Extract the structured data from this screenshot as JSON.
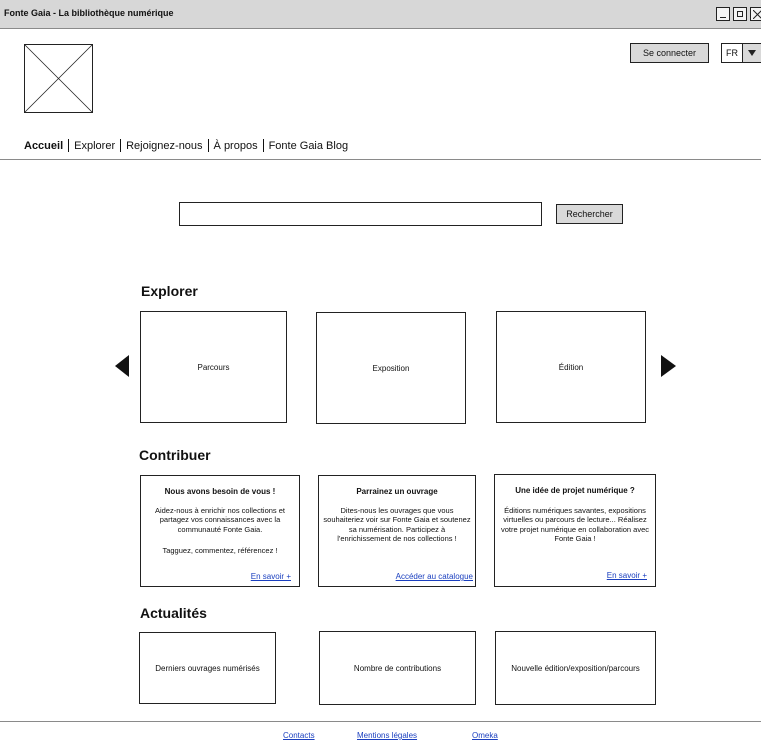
{
  "window": {
    "title": "Fonte Gaia - La bibliothèque numérique"
  },
  "header": {
    "login_label": "Se connecter",
    "language": "FR",
    "nav": [
      "Accueil",
      "Explorer",
      "Rejoignez-nous",
      "À propos",
      "Fonte Gaia Blog"
    ]
  },
  "search": {
    "value": "",
    "placeholder": "",
    "button_label": "Rechercher"
  },
  "explorer": {
    "title": "Explorer",
    "cards": [
      "Parcours",
      "Exposition",
      "Édition"
    ]
  },
  "contribuer": {
    "title": "Contribuer",
    "cards": [
      {
        "title": "Nous avons besoin de vous !",
        "text": "Aidez-nous à enrichir nos collections et partagez vos connaissances avec la communauté Fonte Gaia.",
        "text2": "Tagguez, commentez, référencez !",
        "link": "En savoir +"
      },
      {
        "title": "Parrainez un ouvrage",
        "text": "Dites-nous les ouvrages que vous souhaiteriez voir sur Fonte Gaia et soutenez sa numérisation. Participez à l'enrichissement de nos collections !",
        "text2": "",
        "link": "Accéder au catalogue"
      },
      {
        "title": "Une idée de projet numérique ?",
        "text": "Éditions numériques savantes, expositions virtuelles ou parcours de lecture... Réalisez votre projet numérique en collaboration avec Fonte Gaia !",
        "text2": "",
        "link": "En savoir +"
      }
    ]
  },
  "actualites": {
    "title": "Actualités",
    "cards": [
      "Derniers ouvrages numérisés",
      "Nombre de contributions",
      "Nouvelle édition/exposition/parcours"
    ]
  },
  "footer": {
    "links": [
      "Contacts",
      "Mentions légales",
      "Omeka"
    ]
  },
  "icons": [
    "image-placeholder-icon",
    "minimize-icon",
    "maximize-icon",
    "close-icon",
    "dropdown-arrow-icon",
    "arrow-left-icon",
    "arrow-right-icon"
  ]
}
